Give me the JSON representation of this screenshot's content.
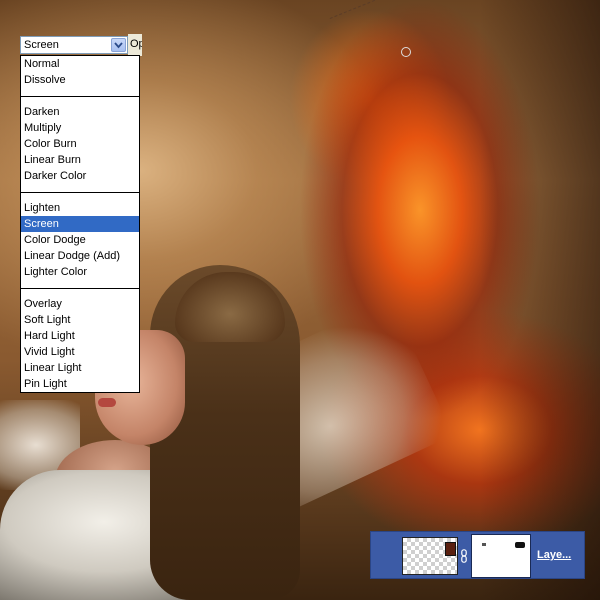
{
  "blend_mode": {
    "selected": "Screen",
    "opacity_label": "Opacity:",
    "groups": [
      [
        "Normal",
        "Dissolve"
      ],
      [
        "Darken",
        "Multiply",
        "Color Burn",
        "Linear Burn",
        "Darker Color"
      ],
      [
        "Lighten",
        "Screen",
        "Color Dodge",
        "Linear Dodge (Add)",
        "Lighter Color"
      ],
      [
        "Overlay",
        "Soft Light",
        "Hard Light",
        "Vivid Light",
        "Linear Light",
        "Pin Light"
      ]
    ]
  },
  "layer_panel": {
    "layer_name": "Laye...",
    "icons": [
      "layer-thumbnail",
      "chain-link-icon",
      "mask-thumbnail"
    ]
  },
  "colors": {
    "selection_highlight": "#316ac5",
    "layer_panel_bg": "#3c5ba6"
  }
}
